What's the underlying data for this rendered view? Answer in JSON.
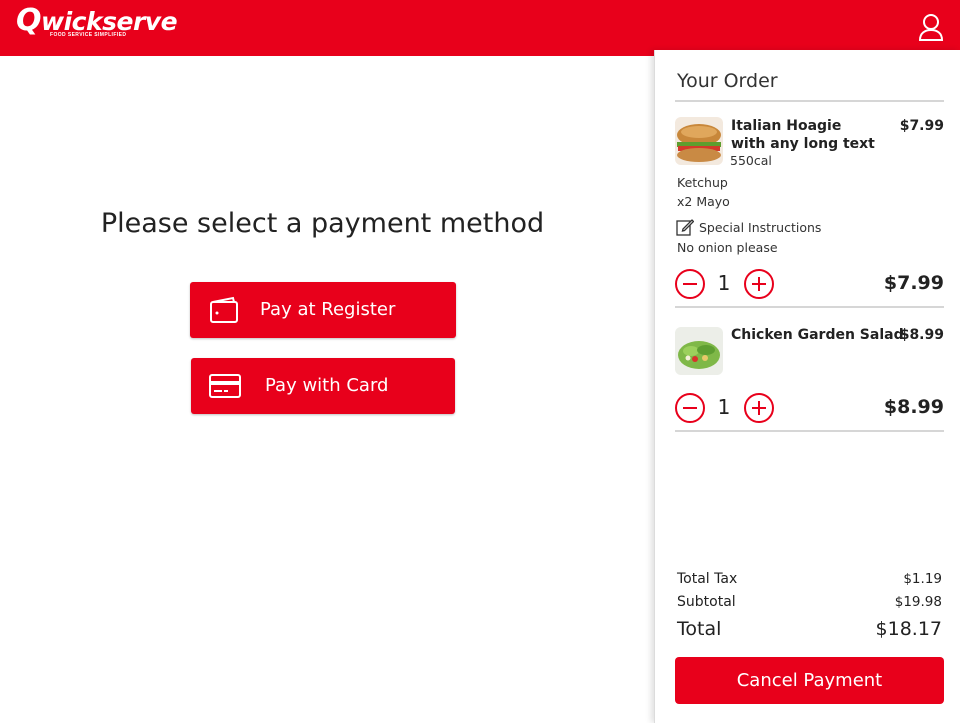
{
  "header": {
    "logo_main": "wickserve",
    "logo_q": "Q",
    "logo_tagline": "FOOD SERVICE SIMPLIFIED",
    "brand_color": "#e8001b",
    "user_icon": "user-icon"
  },
  "main": {
    "prompt": "Please select a payment method",
    "pay_register_label": "Pay at Register",
    "pay_card_label": "Pay with Card",
    "pay_register_icon": "wallet-icon",
    "pay_card_icon": "credit-card-icon"
  },
  "order": {
    "title": "Your Order",
    "items": [
      {
        "name_line1": "Italian Hoagie",
        "name_line2": "with any long text",
        "calories": "550cal",
        "price": "$7.99",
        "modifiers": [
          "Ketchup",
          "x2 Mayo"
        ],
        "special_label": "Special Instructions",
        "special_text": "No onion please",
        "quantity": "1",
        "line_total": "$7.99"
      },
      {
        "name": "Chicken Garden Salad",
        "price": "$8.99",
        "quantity": "1",
        "line_total": "$8.99"
      }
    ],
    "summary": {
      "tax_label": "Total Tax",
      "tax_value": "$1.19",
      "subtotal_label": "Subtotal",
      "subtotal_value": "$19.98",
      "total_label": "Total",
      "total_value": "$18.17"
    },
    "cancel_label": "Cancel Payment"
  }
}
